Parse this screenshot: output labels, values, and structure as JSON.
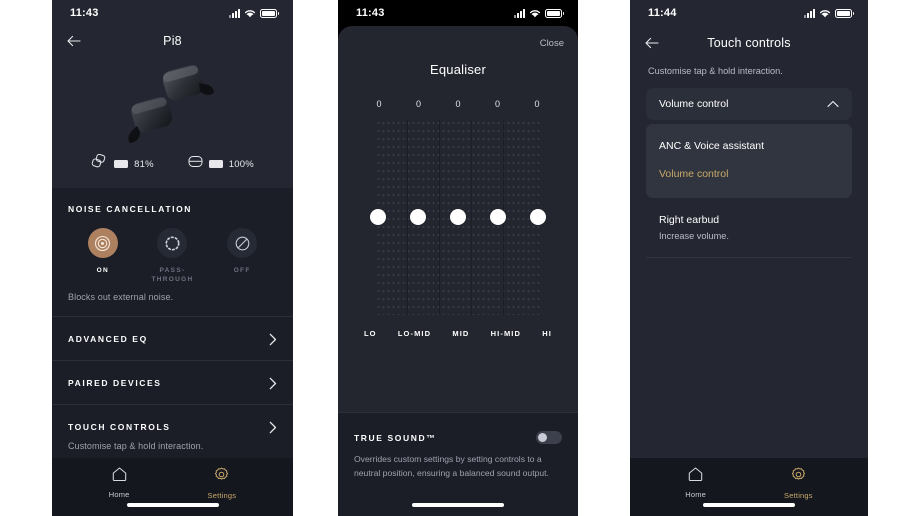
{
  "phone1": {
    "status": {
      "time": "11:43",
      "signal_icon": "signal-bars-icon",
      "wifi_icon": "wifi-icon",
      "battery_icon": "battery-icon"
    },
    "header": {
      "back_icon": "back-arrow-icon",
      "title": "Pi8"
    },
    "hero": {
      "product_image": "earbuds-image"
    },
    "battery": {
      "earbuds": {
        "icon": "earbuds-icon",
        "percent": "81%"
      },
      "case": {
        "icon": "charging-case-icon",
        "percent": "100%"
      }
    },
    "noise_cancellation": {
      "label": "NOISE CANCELLATION",
      "modes": [
        {
          "name": "ON",
          "icon": "anc-on-icon",
          "active": true
        },
        {
          "name": "PASS-THROUGH",
          "icon": "passthrough-icon",
          "active": false
        },
        {
          "name": "OFF",
          "icon": "anc-off-icon",
          "active": false
        }
      ],
      "description": "Blocks out external noise."
    },
    "rows": [
      {
        "label": "ADVANCED EQ",
        "sub": "",
        "chevron": "chevron-right-icon"
      },
      {
        "label": "PAIRED DEVICES",
        "sub": "",
        "chevron": "chevron-right-icon"
      },
      {
        "label": "TOUCH CONTROLS",
        "sub": "Customise tap & hold interaction.",
        "chevron": "chevron-right-icon"
      }
    ],
    "nav": [
      {
        "label": "Home",
        "icon": "home-icon",
        "active": false
      },
      {
        "label": "Settings",
        "icon": "gear-icon",
        "active": true
      }
    ]
  },
  "phone2": {
    "status": {
      "time": "11:43"
    },
    "sheet": {
      "close_label": "Close",
      "title": "Equaliser"
    },
    "truesound": {
      "label": "TRUE SOUND™",
      "toggle_state": "off",
      "description": "Overrides custom settings by setting controls to a neutral position, ensuring a balanced sound output."
    },
    "chart_data": {
      "type": "bar",
      "title": "Equaliser",
      "categories": [
        "LO",
        "LO-MID",
        "MID",
        "HI-MID",
        "HI"
      ],
      "values": [
        0,
        0,
        0,
        0,
        0
      ],
      "value_labels": [
        "0",
        "0",
        "0",
        "0",
        "0"
      ],
      "ylim": [
        -6,
        6
      ],
      "xlabel": "",
      "ylabel": "",
      "grid": true,
      "legend": "none"
    }
  },
  "phone3": {
    "status": {
      "time": "11:44"
    },
    "header": {
      "back_icon": "back-arrow-icon",
      "title": "Touch controls"
    },
    "subtitle": "Customise tap & hold interaction.",
    "select": {
      "value": "Volume control",
      "chevron": "chevron-up-icon"
    },
    "dropdown_options": [
      {
        "label": "ANC & Voice assistant",
        "selected": false
      },
      {
        "label": "Volume control",
        "selected": true
      }
    ],
    "earbud": {
      "title": "Right earbud",
      "sub": "Increase volume."
    },
    "nav": [
      {
        "label": "Home",
        "icon": "home-icon",
        "active": false
      },
      {
        "label": "Settings",
        "icon": "gear-icon",
        "active": true
      }
    ]
  },
  "colors": {
    "background": "#ffffff",
    "panel": "#242732",
    "card": "#1b1e27",
    "accent_gold": "#c9a96a",
    "accent_bronze": "#ad8060",
    "text_primary": "#ffffff",
    "text_muted": "#9ea2ae"
  }
}
